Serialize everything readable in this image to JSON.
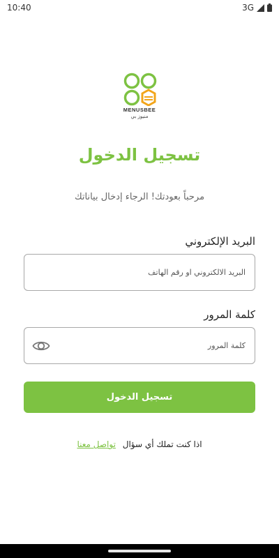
{
  "status_bar": {
    "time": "10:40",
    "network": "3G"
  },
  "logo": {
    "brand_name": "MENUSBEE",
    "brand_name_ar": "منيوز بي"
  },
  "header": {
    "title": "تسجيل الدخول",
    "subtitle": "مرحباً بعودتك! الرجاء إدخال بياناتك"
  },
  "form": {
    "email_label": "البريد الإلكتروني",
    "email_placeholder": "البريد الالكتروني او رقم الهاتف",
    "email_value": "",
    "password_label": "كلمة المرور",
    "password_placeholder": "كلمة المرور",
    "password_value": "",
    "submit_label": "تسجيل الدخول"
  },
  "footer": {
    "question_text": "اذا كنت تملك أي سؤال",
    "contact_link": "تواصل معنا"
  },
  "colors": {
    "accent": "#7dc242",
    "accent_dark": "#5a9e2a",
    "honey": "#f2a51a"
  },
  "icons": {
    "eye_toggle": "eye-icon",
    "signal": "signal-icon",
    "battery": "battery-icon"
  }
}
